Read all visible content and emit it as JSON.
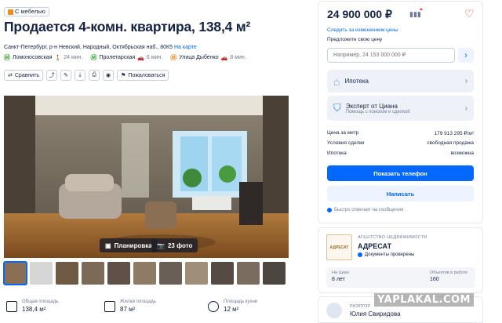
{
  "tag": "С мебелью",
  "title": "Продается 4-комн. квартира, 138,4 м²",
  "address": "Санкт-Петербург, р-н Невский, Народный, Октябрьская наб., 80К5",
  "on_map": "На карте",
  "metro": [
    {
      "name": "Ломоносовская",
      "time": "24 мин.",
      "color": "#3aa935",
      "mode": "walk"
    },
    {
      "name": "Пролетарская",
      "time": "6 мин.",
      "color": "#3aa935",
      "mode": "car"
    },
    {
      "name": "Улица Дыбенко",
      "time": "8 мин.",
      "color": "#f08a24",
      "mode": "car"
    }
  ],
  "toolbar": {
    "compare": "Сравнить",
    "complain": "Пожаловаться"
  },
  "photo": {
    "plan": "Планировка",
    "count": "23 фото"
  },
  "stats": [
    {
      "label": "Общая площадь",
      "value": "138,4 м²"
    },
    {
      "label": "Жилая площадь",
      "value": "87 м²"
    },
    {
      "label": "Площадь кухни",
      "value": "12 м²"
    }
  ],
  "sidebar": {
    "price": "24 900 000 ₽",
    "follow": "Следить за изменением цены",
    "offer_label": "Предложите свою цену",
    "offer_placeholder": "Например, 24 153 000 000 ₽",
    "mortgage": "Ипотека",
    "expert": "Эксперт от Циана",
    "expert_sub": "Помощь с поиском и сделкой",
    "details": [
      {
        "k": "Цена за метр",
        "v": "179 913 295 ₽/м²"
      },
      {
        "k": "Условия сделки",
        "v": "свободная продажа"
      },
      {
        "k": "Ипотека",
        "v": "возможна"
      }
    ],
    "show_phone": "Показать телефон",
    "write": "Написать",
    "fast_reply": "Быстро отвечает на сообщения"
  },
  "agency": {
    "label": "АГЕНТСТВО НЕДВИЖИМОСТИ",
    "name": "АДРЕСАТ",
    "logo": "АДРЕСАТ",
    "verified": "Документы проверены",
    "on_cian_label": "На Циан",
    "on_cian_value": "8 лет",
    "objects_label": "Объектов в работе",
    "objects_value": "160"
  },
  "realtor": {
    "label": "РИЭЛТОР",
    "name": "Юлия Свиридова"
  },
  "watermark": "YAPLAKAL.COM",
  "colors": {
    "accent": "#0468ff",
    "text": "#152242",
    "muted": "#707a95"
  }
}
